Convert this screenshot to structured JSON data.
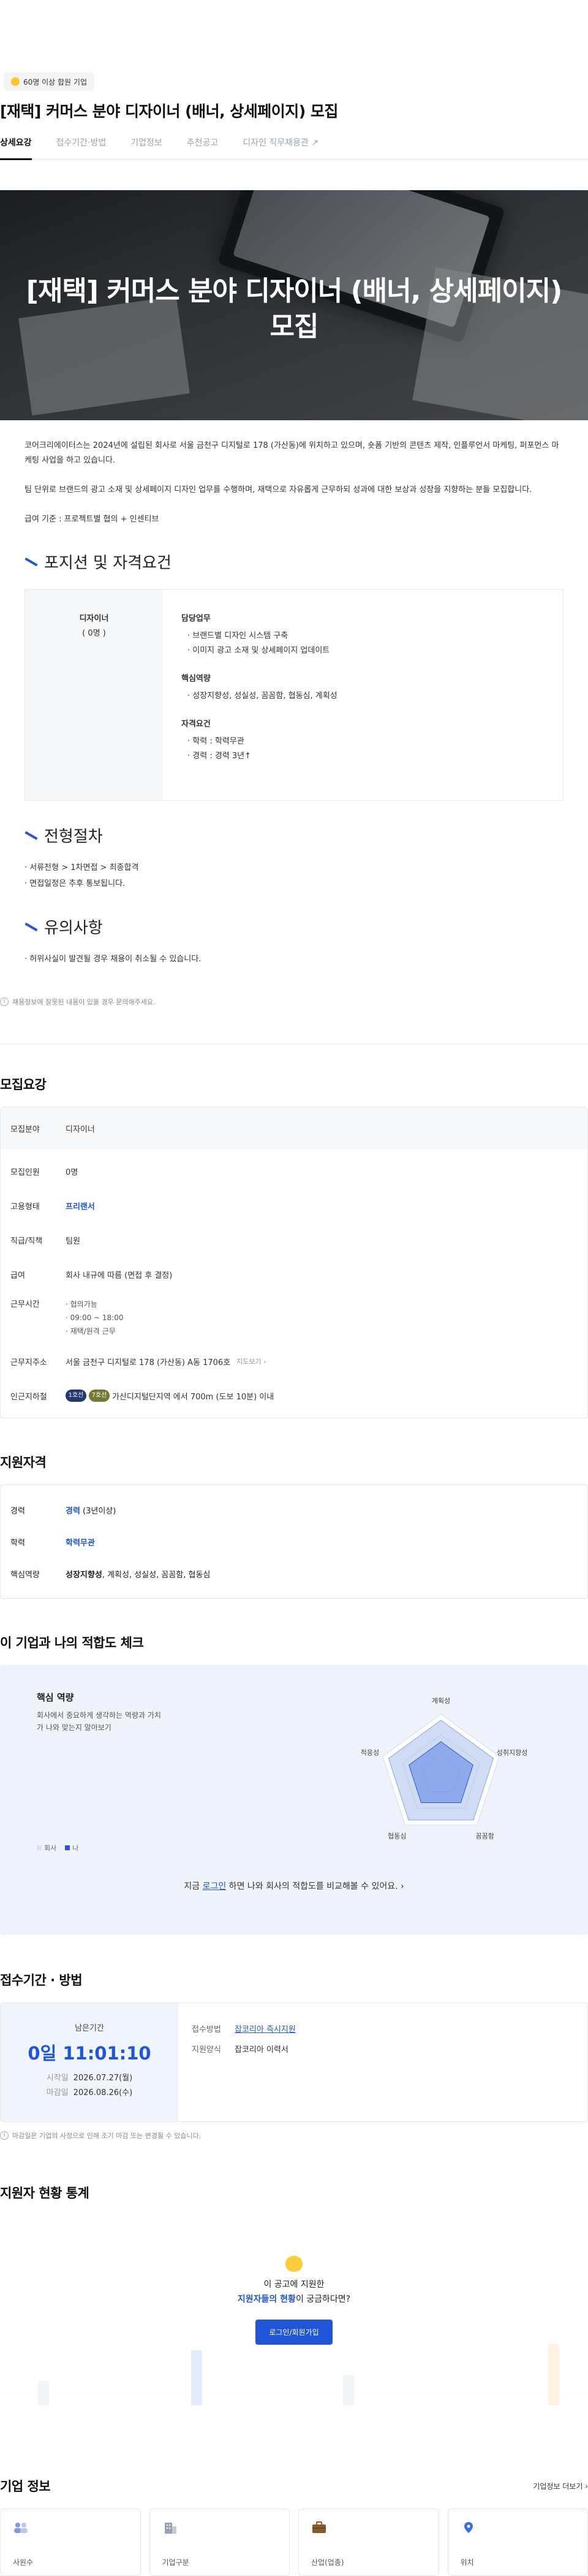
{
  "badge": "60명 이상 합원 기업",
  "job_title": "[재택] 커머스 분야 디자이너 (배너, 상세페이지) 모집",
  "tabs": [
    {
      "label": "상세요강"
    },
    {
      "label": "접수기간·방법"
    },
    {
      "label": "기업정보"
    },
    {
      "label": "추천공고"
    },
    {
      "label": "디자인 직무채용관 ↗"
    }
  ],
  "hero_title": "[재택] 커머스 분야 디자이너 (배너, 상세페이지) 모집",
  "intro": [
    "코어크리에이터스는 2024년에 설립된 회사로 서울 금천구 디지털로 178 (가산동)에 위치하고 있으며, 숏폼 기반의 콘텐츠 제작, 인플루언서 마케팅, 퍼포먼스 마케팅 사업을 하고 있습니다.",
    "팀 단위로 브랜드의 광고 소재 및 상세페이지 디자인 업무를 수행하며, 재택으로 자유롭게 근무하되 성과에 대한 보상과 성장을 지향하는 분들 모집합니다.",
    "급여 기준 : 프로젝트별 협의 + 인센티브"
  ],
  "sections": {
    "position": "포지션 및 자격요건",
    "process": "전형절차",
    "caution": "유의사항"
  },
  "position": {
    "role": "디자이너",
    "count": "( 0명 )",
    "groups": [
      {
        "title": "담당업무",
        "items": [
          "· 브랜드별 디자인 시스템 구축",
          "· 이미지 광고 소재 및 상세페이지 업데이트"
        ]
      },
      {
        "title": "핵심역량",
        "items": [
          "· 성장지향성, 성실성, 꼼꼼함, 협동심, 계획성"
        ]
      },
      {
        "title": "자격요건",
        "items": [
          "· 학력 : 학력무관",
          "· 경력 : 경력 3년↑"
        ]
      }
    ]
  },
  "process": [
    "· 서류전형 > 1차면접 > 최종합격",
    "· 면접일정은 추후 통보됩니다."
  ],
  "caution": [
    "· 허위사실이 발견될 경우 채용이 취소될 수 있습니다."
  ],
  "notice": "채용정보에 잘못된 내용이 있을 경우 문의해주세요.",
  "notice_link": "문의",
  "recruit": {
    "heading": "모집요강",
    "rows": [
      {
        "k": "모집분야",
        "v": "디자이너"
      },
      {
        "k": "모집인원",
        "v": "0명"
      },
      {
        "k": "고용형태",
        "v": "프리랜서"
      },
      {
        "k": "직급/직책",
        "v": "팀원"
      },
      {
        "k": "급여",
        "v": "회사 내규에 따름 (면접 후 결정)"
      },
      {
        "k": "근무시간",
        "items": [
          "협의가능",
          "09:00 ~ 18:00",
          "재택/원격 근무"
        ]
      },
      {
        "k": "근무지주소",
        "v": "서울 금천구 디지털로 178 (가산동) A동 1706호",
        "more": "지도보기 ›"
      },
      {
        "k": "인근지하철",
        "chip1": "1호선",
        "chip2": "7호선",
        "v": "가산디지털단지역 에서 700m (도보 10분) 이내"
      }
    ]
  },
  "qual": {
    "heading": "지원자격",
    "rows": [
      {
        "k": "경력",
        "b": "경력",
        "v": " (3년이상)"
      },
      {
        "k": "학력",
        "b": "학력무관",
        "v": ""
      },
      {
        "k": "핵심역량",
        "b": "성장지향성",
        "v": ", 계획성, 성실성, 꼼꼼함, 협동심"
      }
    ]
  },
  "fit": {
    "heading": "이 기업과 나의 적합도 체크",
    "sub_title": "핵심 역량",
    "desc": "회사에서 중요하게 생각하는 역량과 가치가 나와 맞는지 알아보기",
    "legend_company": "회사",
    "legend_me": "나",
    "axes": [
      "계획성",
      "성취지향성",
      "꼼꼼함",
      "협동심",
      "적응성"
    ],
    "company": [
      0.9,
      0.9,
      0.9,
      0.9,
      0.9
    ],
    "me": [
      0.55,
      0.55,
      0.55,
      0.55,
      0.55
    ],
    "login_prefix": "지금 ",
    "login_link": "로그인",
    "login_suffix": " 하면 나와 회사의 적합도를 비교해볼 수 있어요. ›"
  },
  "period": {
    "heading": "접수기간 · 방법",
    "remain_label": "남은기간",
    "countdown": "0일 11:01:10",
    "start_label": "시작일",
    "start": "2026.07.27(월)",
    "end_label": "마감일",
    "end": "2026.08.26(수)",
    "method_label": "접수방법",
    "method": "잡코리아 즉시지원",
    "form_label": "지원양식",
    "form": "잡코리아 이력서"
  },
  "period_note": "마감일은 기업의 사정으로 인해 조기 마감 또는 변경될 수 있습니다.",
  "stats": {
    "heading": "지원자 현황 통계",
    "line1": "이 공고에 지원한",
    "line2_b": "지원자들의 현황",
    "line2": "이 궁금하다면?",
    "button": "로그인/회원가입"
  },
  "company": {
    "heading": "기업 정보",
    "more": "기업정보 더보기 ›",
    "cards": [
      "사원수",
      "기업구분",
      "산업(업종)",
      "위치"
    ]
  },
  "colors": {
    "accent": "#1f55d6",
    "hero_dark": "#2d3136",
    "fit_bg": "#eef3fc"
  }
}
